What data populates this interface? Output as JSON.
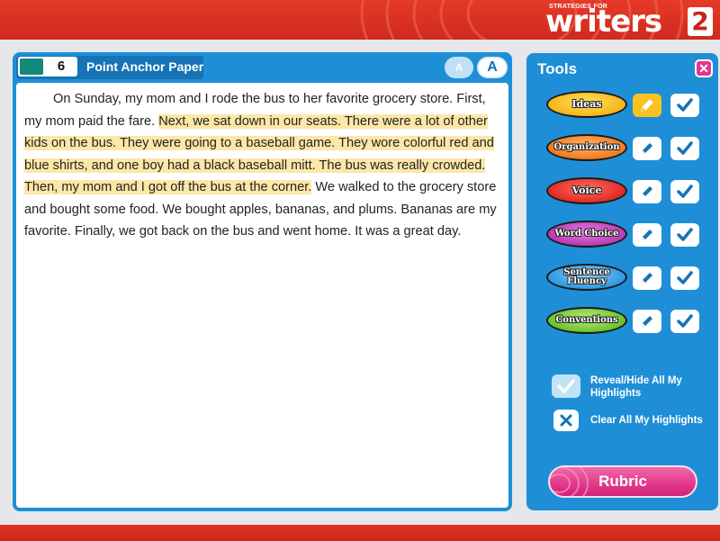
{
  "header": {
    "logo_small": "STRATEGIES FOR",
    "logo_big": "writers",
    "logo_num": "2",
    "color": "#d9301f"
  },
  "paper": {
    "score": "6",
    "score_color": "#12897a",
    "title": "Point Anchor Paper",
    "font_small_label": "A",
    "font_large_label": "A",
    "text_before": "On Sunday, my mom and I rode the bus to her favorite grocery store. First, my mom paid the fare. ",
    "text_highlight": "Next, we sat down in our seats. There were a lot of other kids on the bus. They were going to a baseball game. They wore colorful red and blue shirts, and one boy had a black baseball mitt. The bus was really crowded. Then, my mom and I got off the bus at the corner.",
    "text_after": " We walked to the grocery store and bought some food. We bought apples, bananas, and plums. Bananas are my favorite. Finally, we got back on the bus and went home. It was a great day.",
    "highlight_color": "#fde7a7"
  },
  "tools": {
    "title": "Tools",
    "close_icon": "close-icon",
    "traits": [
      {
        "label": "Ideas",
        "active": true
      },
      {
        "label": "Organization",
        "active": false
      },
      {
        "label": "Voice",
        "active": false
      },
      {
        "label": "Word Choice",
        "active": false
      },
      {
        "label": "Sentence Fluency",
        "active": false
      },
      {
        "label": "Conventions",
        "active": false
      }
    ],
    "reveal_label": "Reveal/Hide All My Highlights",
    "clear_label": "Clear All My Highlights",
    "rubric_label": "Rubric"
  }
}
